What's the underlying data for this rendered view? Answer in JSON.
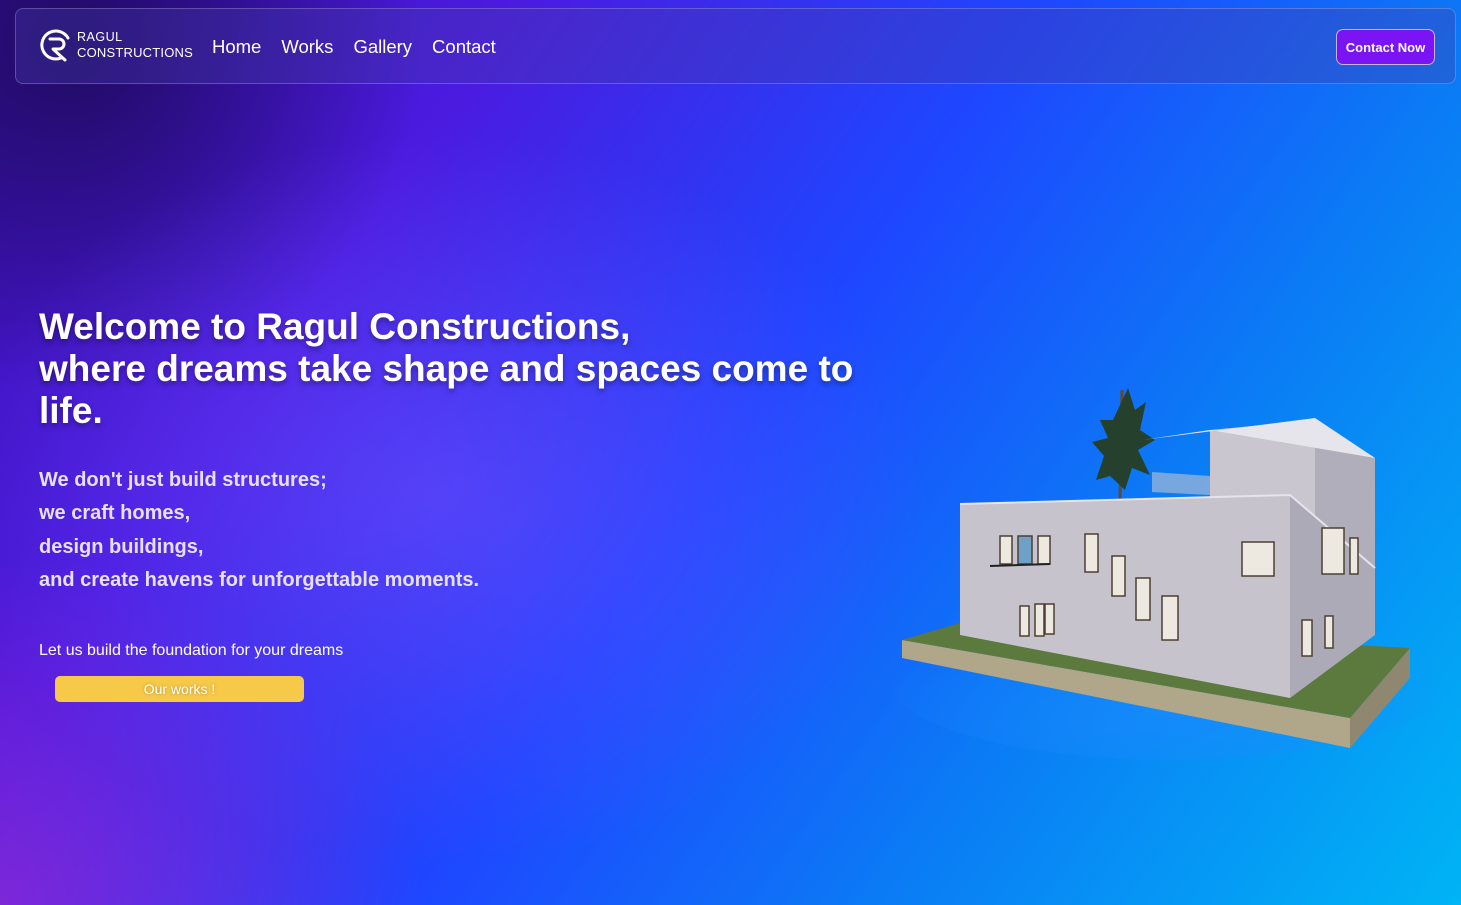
{
  "brand": {
    "line1": "RAGUL",
    "line2": "CONSTRUCTIONS"
  },
  "nav": {
    "links": [
      {
        "label": "Home"
      },
      {
        "label": "Works"
      },
      {
        "label": "Gallery"
      },
      {
        "label": "Contact"
      }
    ],
    "cta_label": "Contact Now"
  },
  "hero": {
    "title_line1": "Welcome to Ragul Constructions,",
    "title_line2": "where dreams take shape and spaces come to life.",
    "lines": [
      "We don't just build structures;",
      "we craft homes,",
      "design buildings,",
      "and create havens for unforgettable moments."
    ],
    "foundation": "Let us build the foundation for your dreams",
    "button_label": "Our works !"
  },
  "colors": {
    "accent_button": "#7a14f5",
    "works_button": "#f7c948"
  }
}
